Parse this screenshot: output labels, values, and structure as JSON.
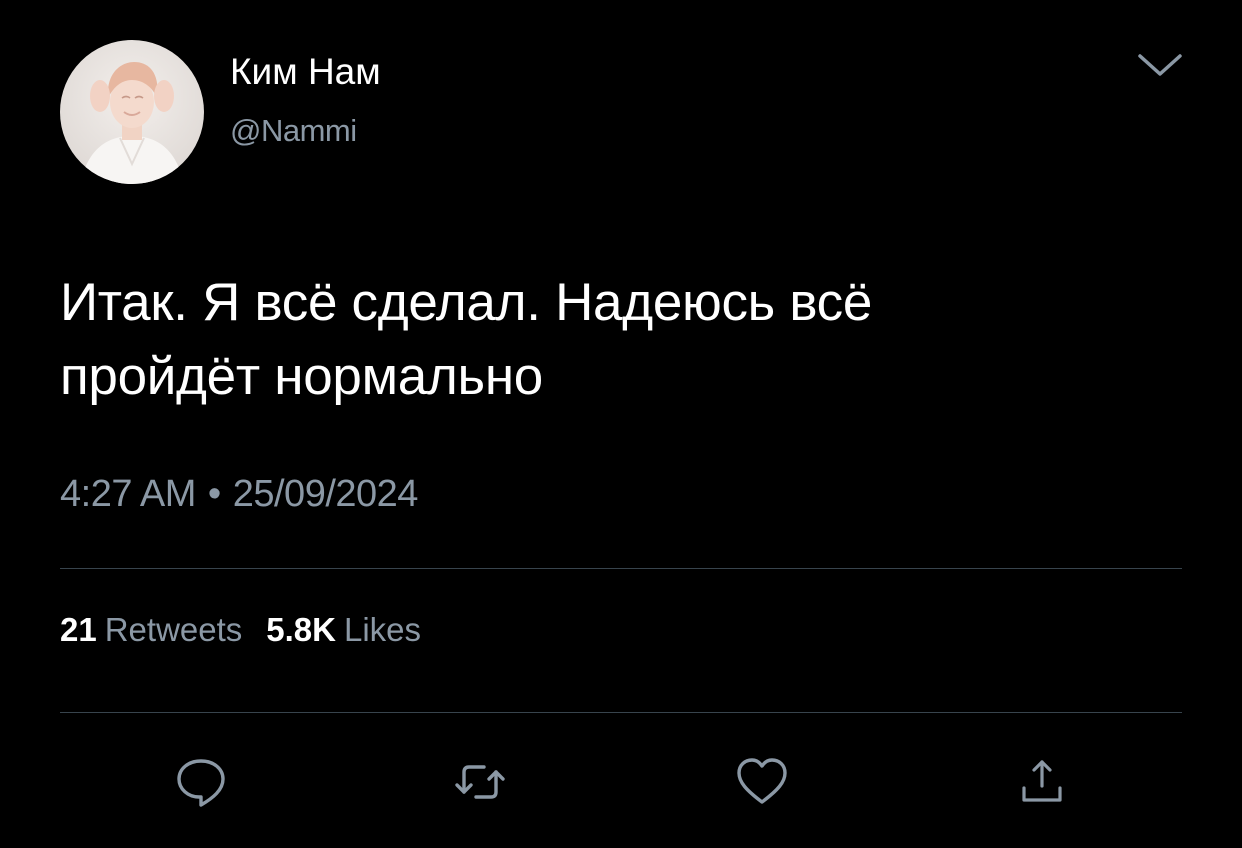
{
  "user": {
    "display_name": "Ким Нам",
    "handle": "@Nammi"
  },
  "tweet": {
    "text_lines": [
      "Итак. Я всё сделал. Надеюсь всё",
      "пройдёт нормально"
    ],
    "time": "4:27 AM",
    "separator": "•",
    "date": "25/09/2024"
  },
  "stats": {
    "retweets_count": "21",
    "retweets_label": "Retweets",
    "likes_count": "5.8K",
    "likes_label": "Likes"
  },
  "icons": {
    "menu": "chevron-down-icon",
    "reply": "reply-icon",
    "retweet": "retweet-icon",
    "like": "heart-icon",
    "share": "share-icon"
  },
  "colors": {
    "background": "#000000",
    "text_primary": "#ffffff",
    "text_secondary": "#8b98a5",
    "divider": "#38444d"
  }
}
